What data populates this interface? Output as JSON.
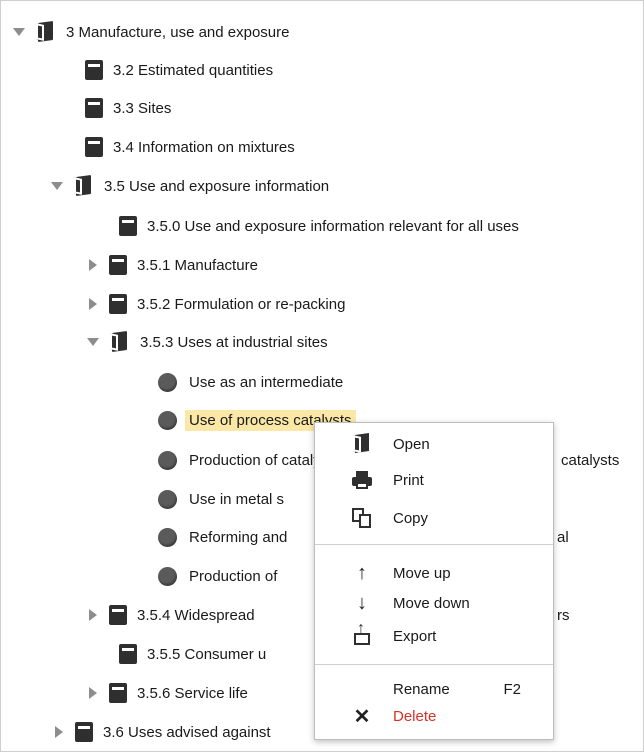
{
  "tree": {
    "rows": [
      {
        "label": "3 Manufacture, use and exposure",
        "arrow": "open",
        "icon": "folder-open"
      },
      {
        "label": "3.2 Estimated quantities",
        "arrow": "none",
        "icon": "doc"
      },
      {
        "label": "3.3 Sites",
        "arrow": "none",
        "icon": "doc"
      },
      {
        "label": "3.4 Information on mixtures",
        "arrow": "none",
        "icon": "doc"
      },
      {
        "label": "3.5 Use and exposure information",
        "arrow": "open",
        "icon": "folder-open"
      },
      {
        "label": "3.5.0 Use and exposure information relevant for all uses",
        "arrow": "none",
        "icon": "doc"
      },
      {
        "label": "3.5.1 Manufacture",
        "arrow": "closed",
        "icon": "doc"
      },
      {
        "label": "3.5.2 Formulation or re-packing",
        "arrow": "closed",
        "icon": "doc"
      },
      {
        "label": "3.5.3 Uses at industrial sites",
        "arrow": "open",
        "icon": "folder-open"
      },
      {
        "label": "Use as an intermediate",
        "arrow": "none",
        "icon": "dot"
      },
      {
        "label": "Use of process catalysts",
        "arrow": "none",
        "icon": "dot",
        "selected": true
      },
      {
        "label": "Production of catalysts",
        "arrow": "none",
        "icon": "dot"
      },
      {
        "label": "Use in metal s",
        "arrow": "none",
        "icon": "dot"
      },
      {
        "label": "Reforming and",
        "arrow": "none",
        "icon": "dot"
      },
      {
        "label": "Production of",
        "arrow": "none",
        "icon": "dot"
      },
      {
        "label": "3.5.4 Widespread",
        "arrow": "closed",
        "icon": "doc"
      },
      {
        "label": "3.5.5 Consumer u",
        "arrow": "none",
        "icon": "doc"
      },
      {
        "label": "3.5.6 Service life",
        "arrow": "closed",
        "icon": "doc"
      },
      {
        "label": "3.6 Uses advised against",
        "arrow": "closed",
        "icon": "doc"
      }
    ],
    "partial_right_texts": {
      "production_catalysts_suffix": "catalysts",
      "reforming_suffix": "al",
      "widespread_suffix": "rs"
    }
  },
  "context_menu": {
    "open": "Open",
    "print": "Print",
    "copy": "Copy",
    "move_up": "Move up",
    "move_down": "Move down",
    "export": "Export",
    "rename": "Rename",
    "rename_shortcut": "F2",
    "delete": "Delete",
    "icons": {
      "open": "folder-open-icon",
      "print": "printer-icon",
      "copy": "copy-icon",
      "move_up": "arrow-up-icon",
      "move_down": "arrow-down-icon",
      "export": "export-icon",
      "delete": "delete-x-icon"
    },
    "colors": {
      "delete": "#d93025",
      "selection": "#fbe8a6"
    }
  }
}
